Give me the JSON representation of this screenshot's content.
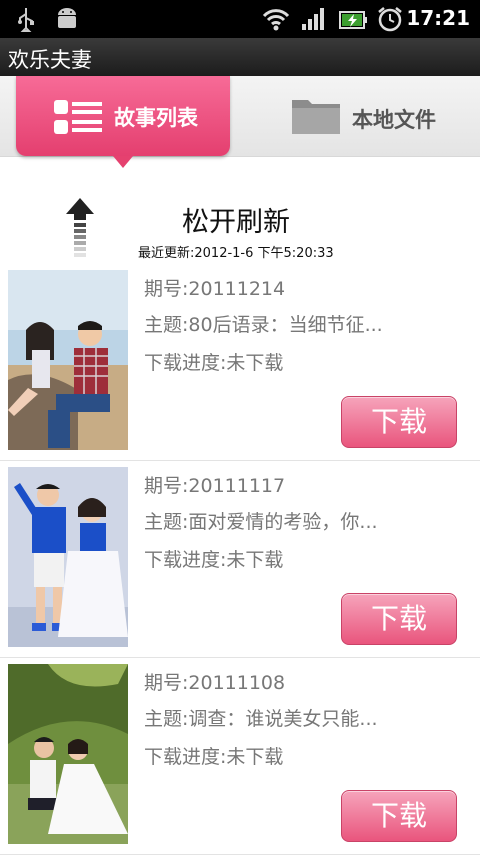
{
  "status_bar": {
    "time": "17:21",
    "icons": [
      "usb-icon",
      "android-debug-icon",
      "wifi-icon",
      "signal-icon",
      "battery-charging-icon",
      "alarm-clock-icon"
    ]
  },
  "app": {
    "title": "欢乐夫妻"
  },
  "tabs": [
    {
      "label": "故事列表",
      "icon": "list-icon",
      "active": true
    },
    {
      "label": "本地文件",
      "icon": "folder-icon",
      "active": false
    }
  ],
  "refresh": {
    "title": "松开刷新",
    "last_updated": "最近更新:2012-1-6 下午5:20:33"
  },
  "stories": [
    {
      "issue": "期号:20111214",
      "topic": "主题:80后语录：当细节征...",
      "progress": "下载进度:未下载",
      "button": "下载"
    },
    {
      "issue": "期号:20111117",
      "topic": "主题:面对爱情的考验，你...",
      "progress": "下载进度:未下载",
      "button": "下载"
    },
    {
      "issue": "期号:20111108",
      "topic": "主题:调查：谁说美女只能...",
      "progress": "下载进度:未下载",
      "button": "下载"
    }
  ],
  "colors": {
    "accent": "#e84b77",
    "status_bar": "#000000",
    "text_secondary": "#777777"
  }
}
